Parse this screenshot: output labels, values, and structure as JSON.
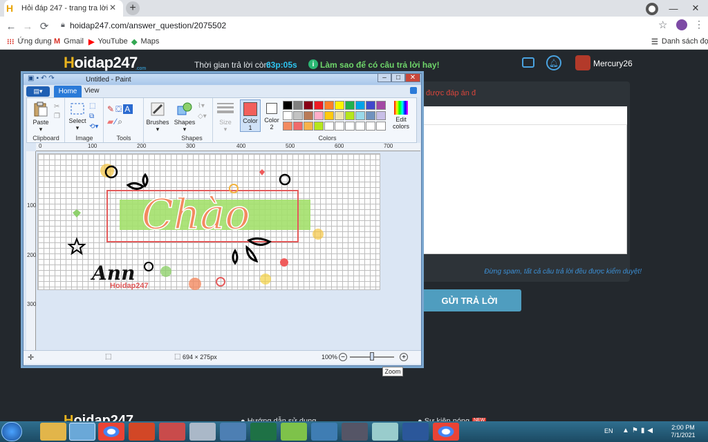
{
  "browser": {
    "tab_title": "Hỏi đáp 247 - trang tra lời",
    "url": "hoidap247.com/answer_question/2075502",
    "bookmarks": [
      "Ứng dụng",
      "Gmail",
      "YouTube",
      "Maps"
    ],
    "reading_list": "Danh sách đọc"
  },
  "site": {
    "logo_prefix": "H",
    "logo_rest": "oidap247",
    "logo_suffix": ".com",
    "timer_label": "Thời gian trả lời còn:",
    "timer_value": "63p:05s",
    "tip": "Làm sao để có câu trả lời hay!",
    "username": "Mercury26",
    "spam_note": "Đừng spam, tất cả câu trả lời đều được kiểm duyệt!",
    "submit": "GỬI TRẢ LỜI",
    "answer_hint": "được đáp án đ",
    "footer_logo_prefix": "H",
    "footer_logo_rest": "oidap247",
    "footer_link_1": "Hướng dẫn sử dụng",
    "footer_link_2": "Sự kiện nóng",
    "new_badge": "NEW",
    "zoom_tooltip": "Zoom"
  },
  "paint": {
    "title": "Untitled - Paint",
    "tab_home": "Home",
    "tab_view": "View",
    "paste": "Paste",
    "select": "Select",
    "brushes": "Brushes",
    "shapes": "Shapes",
    "size": "Size",
    "color1": "Color 1",
    "color2": "Color 2",
    "edit_colors": "Edit colors",
    "groups": {
      "clipboard": "Clipboard",
      "image": "Image",
      "tools": "Tools",
      "shapes": "Shapes",
      "colors": "Colors"
    },
    "ruler": [
      "0",
      "100",
      "200",
      "300",
      "400",
      "500",
      "600",
      "700"
    ],
    "ruler_v": [
      "100",
      "200",
      "300"
    ],
    "image_text": "Chào",
    "signature": "Ann",
    "watermark": "Hoidap247",
    "dimensions": "694 × 275px",
    "zoom": "100%",
    "zoom_level": 0.5,
    "palette_row1": [
      "#000000",
      "#7f7f7f",
      "#880015",
      "#ed1c24",
      "#ff7f27",
      "#fff200",
      "#22b14c",
      "#00a2e8",
      "#3f48cc",
      "#a349a4"
    ],
    "palette_row2": [
      "#ffffff",
      "#c3c3c3",
      "#b97a57",
      "#ffaec9",
      "#ffc90e",
      "#efe4b0",
      "#b5e61d",
      "#99d9ea",
      "#7092be",
      "#c8bfe7"
    ],
    "palette_row3": [
      "#f28a60",
      "#f06a6a",
      "#f7b24a",
      "#b5e61d",
      "#ffffff",
      "#ffffff",
      "#ffffff",
      "#ffffff",
      "#ffffff",
      "#ffffff"
    ],
    "color1_value": "#f25f5c",
    "color2_value": "#ffffff"
  },
  "taskbar": {
    "lang": "EN",
    "time": "2:00 PM",
    "date": "7/1/2021"
  }
}
